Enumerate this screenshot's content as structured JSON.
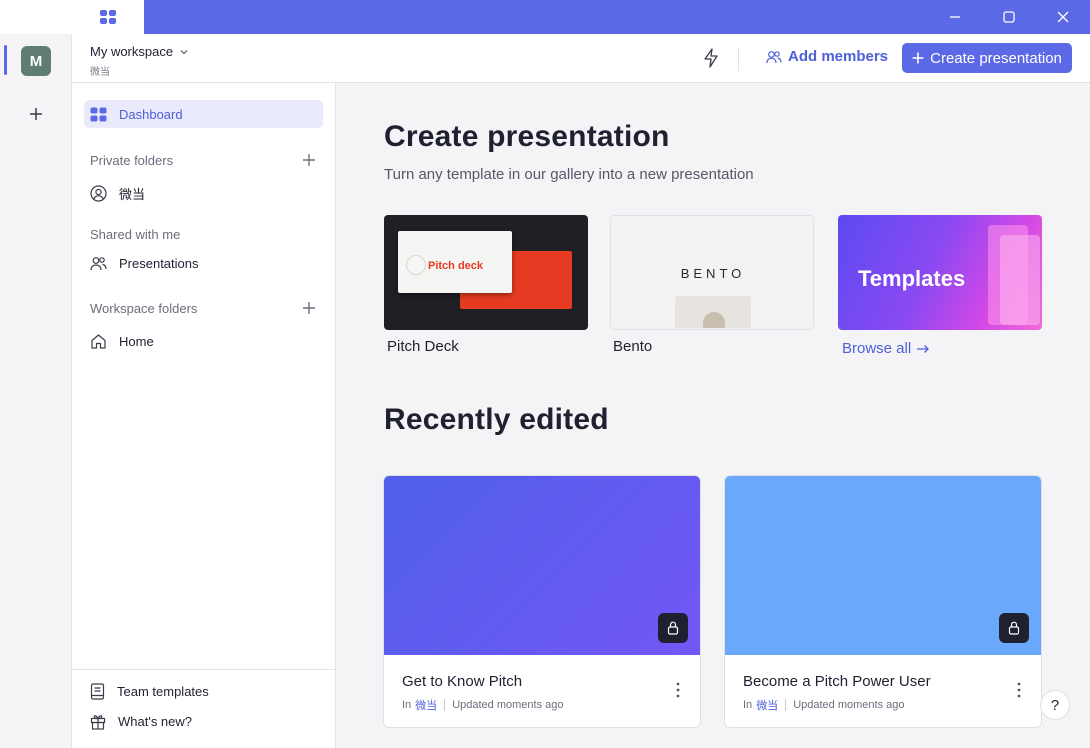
{
  "workspace": {
    "name": "My workspace",
    "subtitle": "微当"
  },
  "rail": {
    "avatar_letter": "M"
  },
  "header": {
    "add_members_label": "Add members",
    "create_label": "Create presentation"
  },
  "sidebar": {
    "dashboard_label": "Dashboard",
    "private_folders_title": "Private folders",
    "private_folder_item": "微当",
    "shared_title": "Shared with me",
    "shared_item": "Presentations",
    "workspace_folders_title": "Workspace folders",
    "workspace_folder_item": "Home",
    "team_templates_label": "Team templates",
    "whats_new_label": "What's new?"
  },
  "main": {
    "create_heading": "Create presentation",
    "create_subtitle": "Turn any template in our gallery into a new presentation",
    "templates": [
      {
        "name": "Pitch Deck",
        "thumb_title": "Pitch deck"
      },
      {
        "name": "Bento",
        "thumb_title": "BENTO"
      },
      {
        "name": "",
        "thumb_title": "Templates"
      }
    ],
    "browse_all_label": "Browse all",
    "recent_heading": "Recently edited",
    "recent": [
      {
        "title": "Get to Know Pitch",
        "in_prefix": "In",
        "folder": "微当",
        "updated": "Updated moments ago",
        "color": "#6a5cf6"
      },
      {
        "title": "Become a Pitch Power User",
        "in_prefix": "In",
        "folder": "微当",
        "updated": "Updated moments ago",
        "color": "#6aa8fb"
      }
    ]
  },
  "help_label": "?",
  "colors": {
    "accent": "#5b69e6",
    "titlebar": "#5b69e6"
  }
}
